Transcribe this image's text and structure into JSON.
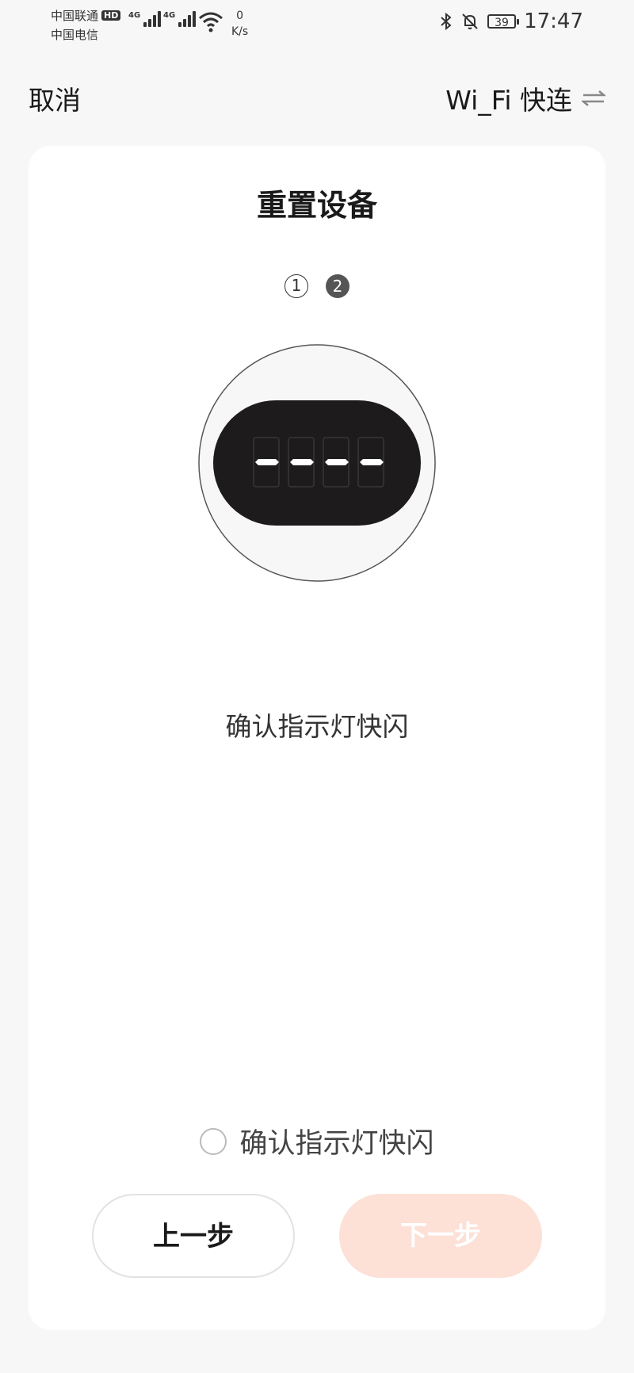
{
  "status_bar": {
    "carrier_1": "中国联通",
    "hd_badge": "HD",
    "carrier_2": "中国电信",
    "network_1": "4G",
    "network_2": "4G",
    "speed_value": "0",
    "speed_unit": "K/s",
    "battery": "39",
    "time": "17:47",
    "icons": [
      "signal-icon",
      "wifi-icon",
      "bluetooth-icon",
      "mute-bell-icon",
      "battery-icon"
    ]
  },
  "nav": {
    "cancel_label": "取消",
    "wifi_switch_label": "Wi_Fi 快连",
    "wifi_switch_icon": "swap-arrows-icon"
  },
  "card": {
    "title": "重置设备",
    "steps": [
      "1",
      "2"
    ],
    "active_step": 2,
    "device_display": "----",
    "hint": "确认指示灯快闪",
    "confirm_label": "确认指示灯快闪",
    "prev_label": "上一步",
    "next_label": "下一步"
  },
  "colors": {
    "background": "#f7f7f7",
    "card": "#ffffff",
    "next_button_disabled": "#fde0d6",
    "device_body": "#1e1b1c",
    "active_step": "#555555"
  }
}
